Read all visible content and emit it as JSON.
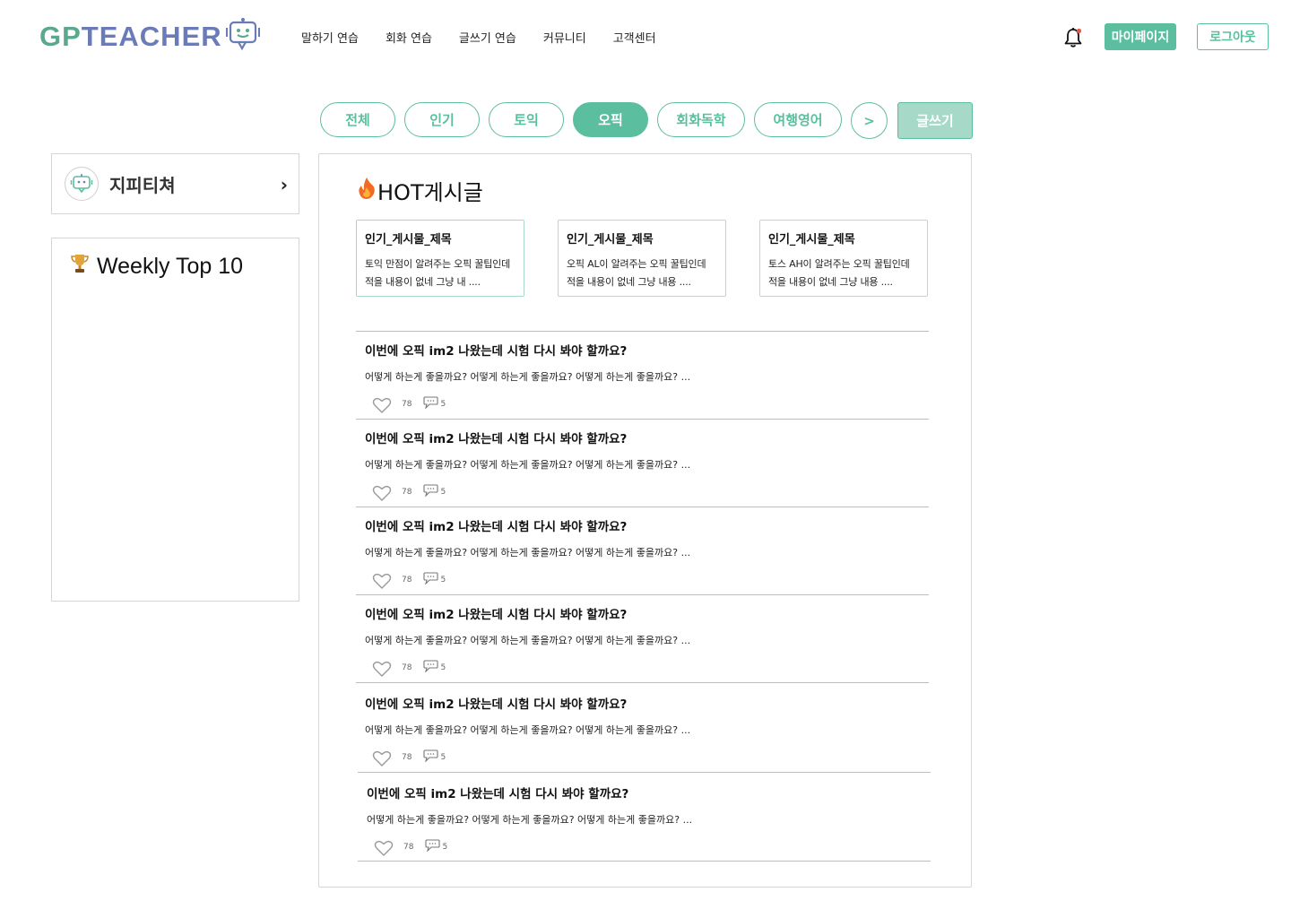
{
  "logo": {
    "part1": "GP",
    "part2": "TEACHER"
  },
  "nav": [
    "말하기 연습",
    "회화 연습",
    "글쓰기 연습",
    "커뮤니티",
    "고객센터"
  ],
  "header": {
    "mypage": "마이페이지",
    "logout": "로그아웃"
  },
  "categories": [
    "전체",
    "인기",
    "토익",
    "오픽",
    "회화독학",
    "여행영어"
  ],
  "active_category": "오픽",
  "more_label": ">",
  "write_label": "글쓰기",
  "profile": {
    "name": "지피티쳐"
  },
  "weekly": {
    "title": "Weekly Top 10"
  },
  "hot": {
    "title": "HOT게시글",
    "cards": [
      {
        "title": "인기_게시물_제목",
        "body": "토익 만점이 알려주는 오픽 꿀팁인데 적을 내용이 없네 그냥 내 ...."
      },
      {
        "title": "인기_게시물_제목",
        "body": "오픽 AL이 알려주는 오픽 꿀팁인데 적을 내용이 없네 그냥 내용 ...."
      },
      {
        "title": "인기_게시물_제목",
        "body": "토스 AH이 알려주는 오픽 꿀팁인데 적을 내용이 없네 그냥 내용 ...."
      }
    ]
  },
  "posts": [
    {
      "title": "이번에 오픽 im2 나왔는데 시험 다시 봐야 할까요?",
      "body": "어떻게 하는게 좋을까요? 어떻게 하는게 좋을까요? 어떻게 하는게 좋을까요? ...",
      "likes": "78",
      "comments": "5"
    },
    {
      "title": "이번에 오픽 im2 나왔는데 시험 다시 봐야 할까요?",
      "body": "어떻게 하는게 좋을까요? 어떻게 하는게 좋을까요? 어떻게 하는게 좋을까요? ...",
      "likes": "78",
      "comments": "5"
    },
    {
      "title": "이번에 오픽 im2 나왔는데 시험 다시 봐야 할까요?",
      "body": "어떻게 하는게 좋을까요? 어떻게 하는게 좋을까요? 어떻게 하는게 좋을까요? ...",
      "likes": "78",
      "comments": "5"
    },
    {
      "title": "이번에 오픽 im2 나왔는데 시험 다시 봐야 할까요?",
      "body": "어떻게 하는게 좋을까요? 어떻게 하는게 좋을까요? 어떻게 하는게 좋을까요? ...",
      "likes": "78",
      "comments": "5"
    },
    {
      "title": "이번에 오픽 im2 나왔는데 시험 다시 봐야 할까요?",
      "body": "어떻게 하는게 좋을까요? 어떻게 하는게 좋을까요? 어떻게 하는게 좋을까요? ...",
      "likes": "78",
      "comments": "5"
    },
    {
      "title": "이번에 오픽 im2 나왔는데 시험 다시 봐야 할까요?",
      "body": "어떻게 하는게 좋을까요? 어떻게 하는게 좋을까요? 어떻게 하는게 좋을까요? ...",
      "likes": "78",
      "comments": "5"
    }
  ],
  "colors": {
    "accent": "#5bbf9f",
    "accent_light": "#a6d9c7",
    "logo_purple": "#6b7bb8",
    "notification_dot": "#e05a4f"
  },
  "icons": {
    "bell": "bell-icon",
    "chevron": "chevron-right-icon",
    "trophy": "trophy-icon",
    "fire": "fire-icon",
    "heart": "heart-icon",
    "comment": "comment-icon",
    "robot": "robot-icon"
  }
}
